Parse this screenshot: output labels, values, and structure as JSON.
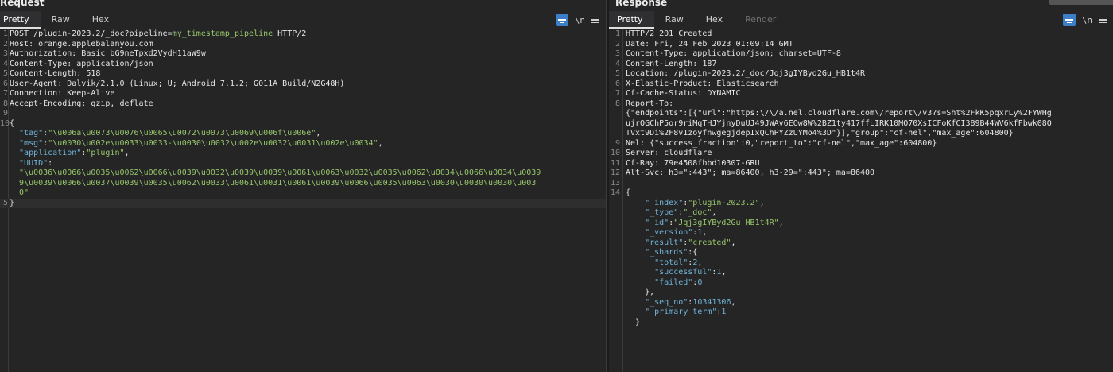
{
  "request": {
    "title": "Request",
    "tabs": [
      "Pretty",
      "Raw",
      "Hex"
    ],
    "active_tab": "Pretty",
    "tools": {
      "newline_label": "\\n"
    },
    "lines": [
      {
        "no": "1",
        "parts": [
          [
            "k",
            "POST /plugin-2023.2/_doc?pipeline="
          ],
          [
            "s",
            "my_timestamp_pipeline"
          ],
          [
            "k",
            " HTTP/2"
          ]
        ]
      },
      {
        "no": "2",
        "parts": [
          [
            "k",
            "Host: orange.applebalanyou.com"
          ]
        ]
      },
      {
        "no": "3",
        "parts": [
          [
            "k",
            "Authorization: Basic bG9neTpxd2VydH11aW9w"
          ]
        ]
      },
      {
        "no": "4",
        "parts": [
          [
            "k",
            "Content-Type: application/json"
          ]
        ]
      },
      {
        "no": "5",
        "parts": [
          [
            "k",
            "Content-Length: 518"
          ]
        ]
      },
      {
        "no": "6",
        "parts": [
          [
            "k",
            "User-Agent: Dalvik/2.1.0 (Linux; U; Android 7.1.2; G011A Build/N2G48H)"
          ]
        ]
      },
      {
        "no": "7",
        "parts": [
          [
            "k",
            "Connection: Keep-Alive"
          ]
        ]
      },
      {
        "no": "8",
        "parts": [
          [
            "k",
            "Accept-Encoding: gzip, deflate"
          ]
        ]
      },
      {
        "no": "9",
        "parts": []
      },
      {
        "no": "10",
        "parts": [
          [
            "p",
            "{"
          ]
        ]
      },
      {
        "no": "",
        "parts": [
          [
            "q",
            "  \"tag\""
          ],
          [
            "p",
            ":"
          ],
          [
            "s",
            "\"\\u006a\\u0073\\u0076\\u0065\\u0072\\u0073\\u0069\\u006f\\u006e\""
          ],
          [
            "p",
            ","
          ]
        ]
      },
      {
        "no": "",
        "parts": [
          [
            "q",
            "  \"msg\""
          ],
          [
            "p",
            ":"
          ],
          [
            "s",
            "\"\\u0030\\u002e\\u0033\\u0033-\\u0030\\u0032\\u002e\\u0032\\u0031\\u002e\\u0034\""
          ],
          [
            "p",
            ","
          ]
        ]
      },
      {
        "no": "",
        "parts": [
          [
            "q",
            "  \"application\""
          ],
          [
            "p",
            ":"
          ],
          [
            "s",
            "\"plugin\""
          ],
          [
            "p",
            ","
          ]
        ]
      },
      {
        "no": "",
        "parts": [
          [
            "q",
            "  \"UUID\""
          ],
          [
            "p",
            ":"
          ]
        ]
      },
      {
        "no": "",
        "parts": [
          [
            "s",
            "  \"\\u0036\\u0066\\u0035\\u0062\\u0066\\u0039\\u0032\\u0039\\u0039\\u0061\\u0063\\u0032\\u0035\\u0062\\u0034\\u0066\\u0034\\u0039"
          ]
        ]
      },
      {
        "no": "",
        "parts": [
          [
            "s",
            "  9\\u0039\\u0066\\u0037\\u0039\\u0035\\u0062\\u0033\\u0061\\u0031\\u0061\\u0039\\u0066\\u0035\\u0063\\u0030\\u0030\\u0030\\u003"
          ]
        ]
      },
      {
        "no": "",
        "parts": [
          [
            "s",
            "  0\""
          ]
        ]
      },
      {
        "no": "5",
        "parts": [
          [
            "p",
            "}"
          ]
        ],
        "highlight": true
      }
    ]
  },
  "response": {
    "title": "Response",
    "tabs": [
      "Pretty",
      "Raw",
      "Hex",
      "Render"
    ],
    "active_tab": "Pretty",
    "disabled_tab": "Render",
    "tools": {
      "newline_label": "\\n"
    },
    "lines": [
      {
        "no": "1",
        "parts": [
          [
            "k",
            "HTTP/2 201 Created"
          ]
        ]
      },
      {
        "no": "2",
        "parts": [
          [
            "k",
            "Date: Fri, 24 Feb 2023 01:09:14 GMT"
          ]
        ]
      },
      {
        "no": "3",
        "parts": [
          [
            "k",
            "Content-Type: application/json; charset=UTF-8"
          ]
        ]
      },
      {
        "no": "4",
        "parts": [
          [
            "k",
            "Content-Length: 187"
          ]
        ]
      },
      {
        "no": "5",
        "parts": [
          [
            "k",
            "Location: /plugin-2023.2/_doc/Jqj3gIYByd2Gu_HB1t4R"
          ]
        ]
      },
      {
        "no": "6",
        "parts": [
          [
            "k",
            "X-Elastic-Product: Elasticsearch"
          ]
        ]
      },
      {
        "no": "7",
        "parts": [
          [
            "k",
            "Cf-Cache-Status: DYNAMIC"
          ]
        ]
      },
      {
        "no": "8",
        "parts": [
          [
            "k",
            "Report-To:"
          ]
        ]
      },
      {
        "no": "",
        "parts": [
          [
            "k",
            "{\"endpoints\":[{\"url\":\"https:\\/\\/a.nel.cloudflare.com\\/report\\/v3?s=Sht%2FkK5pqxrLy%2FYWHg"
          ]
        ]
      },
      {
        "no": "",
        "parts": [
          [
            "k",
            "ujrQGChP5or9riMqTHJYjnyDuUJ49JWAv6EOw8W%2BZ1ty417ffLIRK10MO70XsICFoKfCI389B44WV6kfFbwk08Q"
          ]
        ]
      },
      {
        "no": "",
        "parts": [
          [
            "k",
            "TVxt9Di%2F8v1zoyfnwgegjdepIxQChPYZzUYMo4%3D\"}],\"group\":\"cf-nel\",\"max_age\":604800}"
          ]
        ]
      },
      {
        "no": "9",
        "parts": [
          [
            "k",
            "Nel: {\"success_fraction\":0,\"report_to\":\"cf-nel\",\"max_age\":604800}"
          ]
        ]
      },
      {
        "no": "10",
        "parts": [
          [
            "k",
            "Server: cloudflare"
          ]
        ]
      },
      {
        "no": "11",
        "parts": [
          [
            "k",
            "Cf-Ray: 79e4508fbbd10307-GRU"
          ]
        ]
      },
      {
        "no": "12",
        "parts": [
          [
            "k",
            "Alt-Svc: h3=\":443\"; ma=86400, h3-29=\":443\"; ma=86400"
          ]
        ]
      },
      {
        "no": "13",
        "parts": []
      },
      {
        "no": "14",
        "parts": [
          [
            "p",
            "{"
          ]
        ]
      },
      {
        "no": "",
        "parts": [
          [
            "q",
            "    \"_index\""
          ],
          [
            "p",
            ":"
          ],
          [
            "s",
            "\"plugin-2023.2\""
          ],
          [
            "p",
            ","
          ]
        ]
      },
      {
        "no": "",
        "parts": [
          [
            "q",
            "    \"_type\""
          ],
          [
            "p",
            ":"
          ],
          [
            "s",
            "\"_doc\""
          ],
          [
            "p",
            ","
          ]
        ]
      },
      {
        "no": "",
        "parts": [
          [
            "q",
            "    \"_id\""
          ],
          [
            "p",
            ":"
          ],
          [
            "s",
            "\"Jqj3gIYByd2Gu_HB1t4R\""
          ],
          [
            "p",
            ","
          ]
        ]
      },
      {
        "no": "",
        "parts": [
          [
            "q",
            "    \"_version\""
          ],
          [
            "p",
            ":"
          ],
          [
            "n",
            "1"
          ],
          [
            "p",
            ","
          ]
        ]
      },
      {
        "no": "",
        "parts": [
          [
            "q",
            "    \"result\""
          ],
          [
            "p",
            ":"
          ],
          [
            "s",
            "\"created\""
          ],
          [
            "p",
            ","
          ]
        ]
      },
      {
        "no": "",
        "parts": [
          [
            "q",
            "    \"_shards\""
          ],
          [
            "p",
            ":{"
          ]
        ]
      },
      {
        "no": "",
        "parts": [
          [
            "q",
            "      \"total\""
          ],
          [
            "p",
            ":"
          ],
          [
            "n",
            "2"
          ],
          [
            "p",
            ","
          ]
        ]
      },
      {
        "no": "",
        "parts": [
          [
            "q",
            "      \"successful\""
          ],
          [
            "p",
            ":"
          ],
          [
            "n",
            "1"
          ],
          [
            "p",
            ","
          ]
        ]
      },
      {
        "no": "",
        "parts": [
          [
            "q",
            "      \"failed\""
          ],
          [
            "p",
            ":"
          ],
          [
            "n",
            "0"
          ]
        ]
      },
      {
        "no": "",
        "parts": [
          [
            "p",
            "    },"
          ]
        ]
      },
      {
        "no": "",
        "parts": [
          [
            "q",
            "    \"_seq_no\""
          ],
          [
            "p",
            ":"
          ],
          [
            "n",
            "10341306"
          ],
          [
            "p",
            ","
          ]
        ]
      },
      {
        "no": "",
        "parts": [
          [
            "q",
            "    \"_primary_term\""
          ],
          [
            "p",
            ":"
          ],
          [
            "n",
            "1"
          ]
        ]
      },
      {
        "no": "",
        "parts": [
          [
            "p",
            "  }"
          ]
        ]
      }
    ]
  },
  "colors": {
    "background": "#252526",
    "accent": "#3d7ec9",
    "string": "#97c76b",
    "key": "#6fb3d6"
  }
}
